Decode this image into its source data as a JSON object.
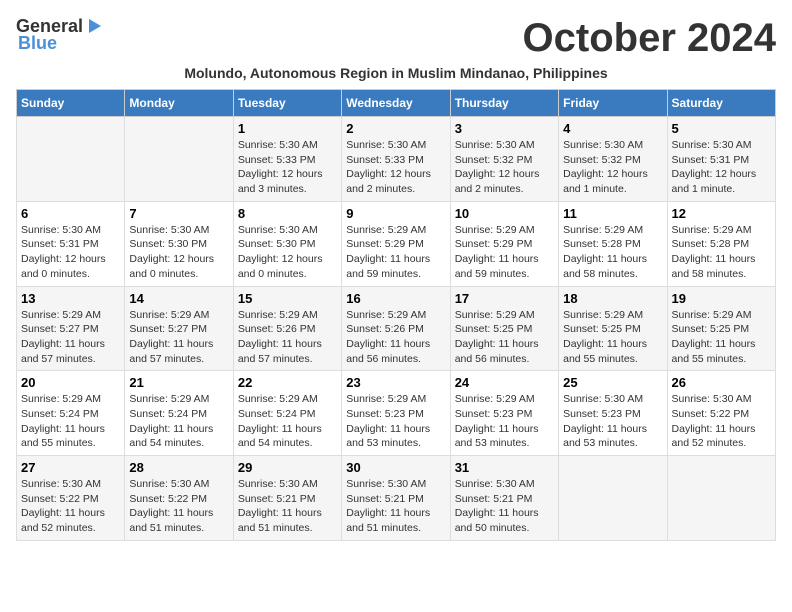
{
  "header": {
    "logo_general": "General",
    "logo_blue": "Blue",
    "month_title": "October 2024",
    "subtitle": "Molundo, Autonomous Region in Muslim Mindanao, Philippines"
  },
  "days_of_week": [
    "Sunday",
    "Monday",
    "Tuesday",
    "Wednesday",
    "Thursday",
    "Friday",
    "Saturday"
  ],
  "weeks": [
    [
      {
        "day": "",
        "info": ""
      },
      {
        "day": "",
        "info": ""
      },
      {
        "day": "1",
        "info": "Sunrise: 5:30 AM\nSunset: 5:33 PM\nDaylight: 12 hours\nand 3 minutes."
      },
      {
        "day": "2",
        "info": "Sunrise: 5:30 AM\nSunset: 5:33 PM\nDaylight: 12 hours\nand 2 minutes."
      },
      {
        "day": "3",
        "info": "Sunrise: 5:30 AM\nSunset: 5:32 PM\nDaylight: 12 hours\nand 2 minutes."
      },
      {
        "day": "4",
        "info": "Sunrise: 5:30 AM\nSunset: 5:32 PM\nDaylight: 12 hours\nand 1 minute."
      },
      {
        "day": "5",
        "info": "Sunrise: 5:30 AM\nSunset: 5:31 PM\nDaylight: 12 hours\nand 1 minute."
      }
    ],
    [
      {
        "day": "6",
        "info": "Sunrise: 5:30 AM\nSunset: 5:31 PM\nDaylight: 12 hours\nand 0 minutes."
      },
      {
        "day": "7",
        "info": "Sunrise: 5:30 AM\nSunset: 5:30 PM\nDaylight: 12 hours\nand 0 minutes."
      },
      {
        "day": "8",
        "info": "Sunrise: 5:30 AM\nSunset: 5:30 PM\nDaylight: 12 hours\nand 0 minutes."
      },
      {
        "day": "9",
        "info": "Sunrise: 5:29 AM\nSunset: 5:29 PM\nDaylight: 11 hours\nand 59 minutes."
      },
      {
        "day": "10",
        "info": "Sunrise: 5:29 AM\nSunset: 5:29 PM\nDaylight: 11 hours\nand 59 minutes."
      },
      {
        "day": "11",
        "info": "Sunrise: 5:29 AM\nSunset: 5:28 PM\nDaylight: 11 hours\nand 58 minutes."
      },
      {
        "day": "12",
        "info": "Sunrise: 5:29 AM\nSunset: 5:28 PM\nDaylight: 11 hours\nand 58 minutes."
      }
    ],
    [
      {
        "day": "13",
        "info": "Sunrise: 5:29 AM\nSunset: 5:27 PM\nDaylight: 11 hours\nand 57 minutes."
      },
      {
        "day": "14",
        "info": "Sunrise: 5:29 AM\nSunset: 5:27 PM\nDaylight: 11 hours\nand 57 minutes."
      },
      {
        "day": "15",
        "info": "Sunrise: 5:29 AM\nSunset: 5:26 PM\nDaylight: 11 hours\nand 57 minutes."
      },
      {
        "day": "16",
        "info": "Sunrise: 5:29 AM\nSunset: 5:26 PM\nDaylight: 11 hours\nand 56 minutes."
      },
      {
        "day": "17",
        "info": "Sunrise: 5:29 AM\nSunset: 5:25 PM\nDaylight: 11 hours\nand 56 minutes."
      },
      {
        "day": "18",
        "info": "Sunrise: 5:29 AM\nSunset: 5:25 PM\nDaylight: 11 hours\nand 55 minutes."
      },
      {
        "day": "19",
        "info": "Sunrise: 5:29 AM\nSunset: 5:25 PM\nDaylight: 11 hours\nand 55 minutes."
      }
    ],
    [
      {
        "day": "20",
        "info": "Sunrise: 5:29 AM\nSunset: 5:24 PM\nDaylight: 11 hours\nand 55 minutes."
      },
      {
        "day": "21",
        "info": "Sunrise: 5:29 AM\nSunset: 5:24 PM\nDaylight: 11 hours\nand 54 minutes."
      },
      {
        "day": "22",
        "info": "Sunrise: 5:29 AM\nSunset: 5:24 PM\nDaylight: 11 hours\nand 54 minutes."
      },
      {
        "day": "23",
        "info": "Sunrise: 5:29 AM\nSunset: 5:23 PM\nDaylight: 11 hours\nand 53 minutes."
      },
      {
        "day": "24",
        "info": "Sunrise: 5:29 AM\nSunset: 5:23 PM\nDaylight: 11 hours\nand 53 minutes."
      },
      {
        "day": "25",
        "info": "Sunrise: 5:30 AM\nSunset: 5:23 PM\nDaylight: 11 hours\nand 53 minutes."
      },
      {
        "day": "26",
        "info": "Sunrise: 5:30 AM\nSunset: 5:22 PM\nDaylight: 11 hours\nand 52 minutes."
      }
    ],
    [
      {
        "day": "27",
        "info": "Sunrise: 5:30 AM\nSunset: 5:22 PM\nDaylight: 11 hours\nand 52 minutes."
      },
      {
        "day": "28",
        "info": "Sunrise: 5:30 AM\nSunset: 5:22 PM\nDaylight: 11 hours\nand 51 minutes."
      },
      {
        "day": "29",
        "info": "Sunrise: 5:30 AM\nSunset: 5:21 PM\nDaylight: 11 hours\nand 51 minutes."
      },
      {
        "day": "30",
        "info": "Sunrise: 5:30 AM\nSunset: 5:21 PM\nDaylight: 11 hours\nand 51 minutes."
      },
      {
        "day": "31",
        "info": "Sunrise: 5:30 AM\nSunset: 5:21 PM\nDaylight: 11 hours\nand 50 minutes."
      },
      {
        "day": "",
        "info": ""
      },
      {
        "day": "",
        "info": ""
      }
    ]
  ]
}
